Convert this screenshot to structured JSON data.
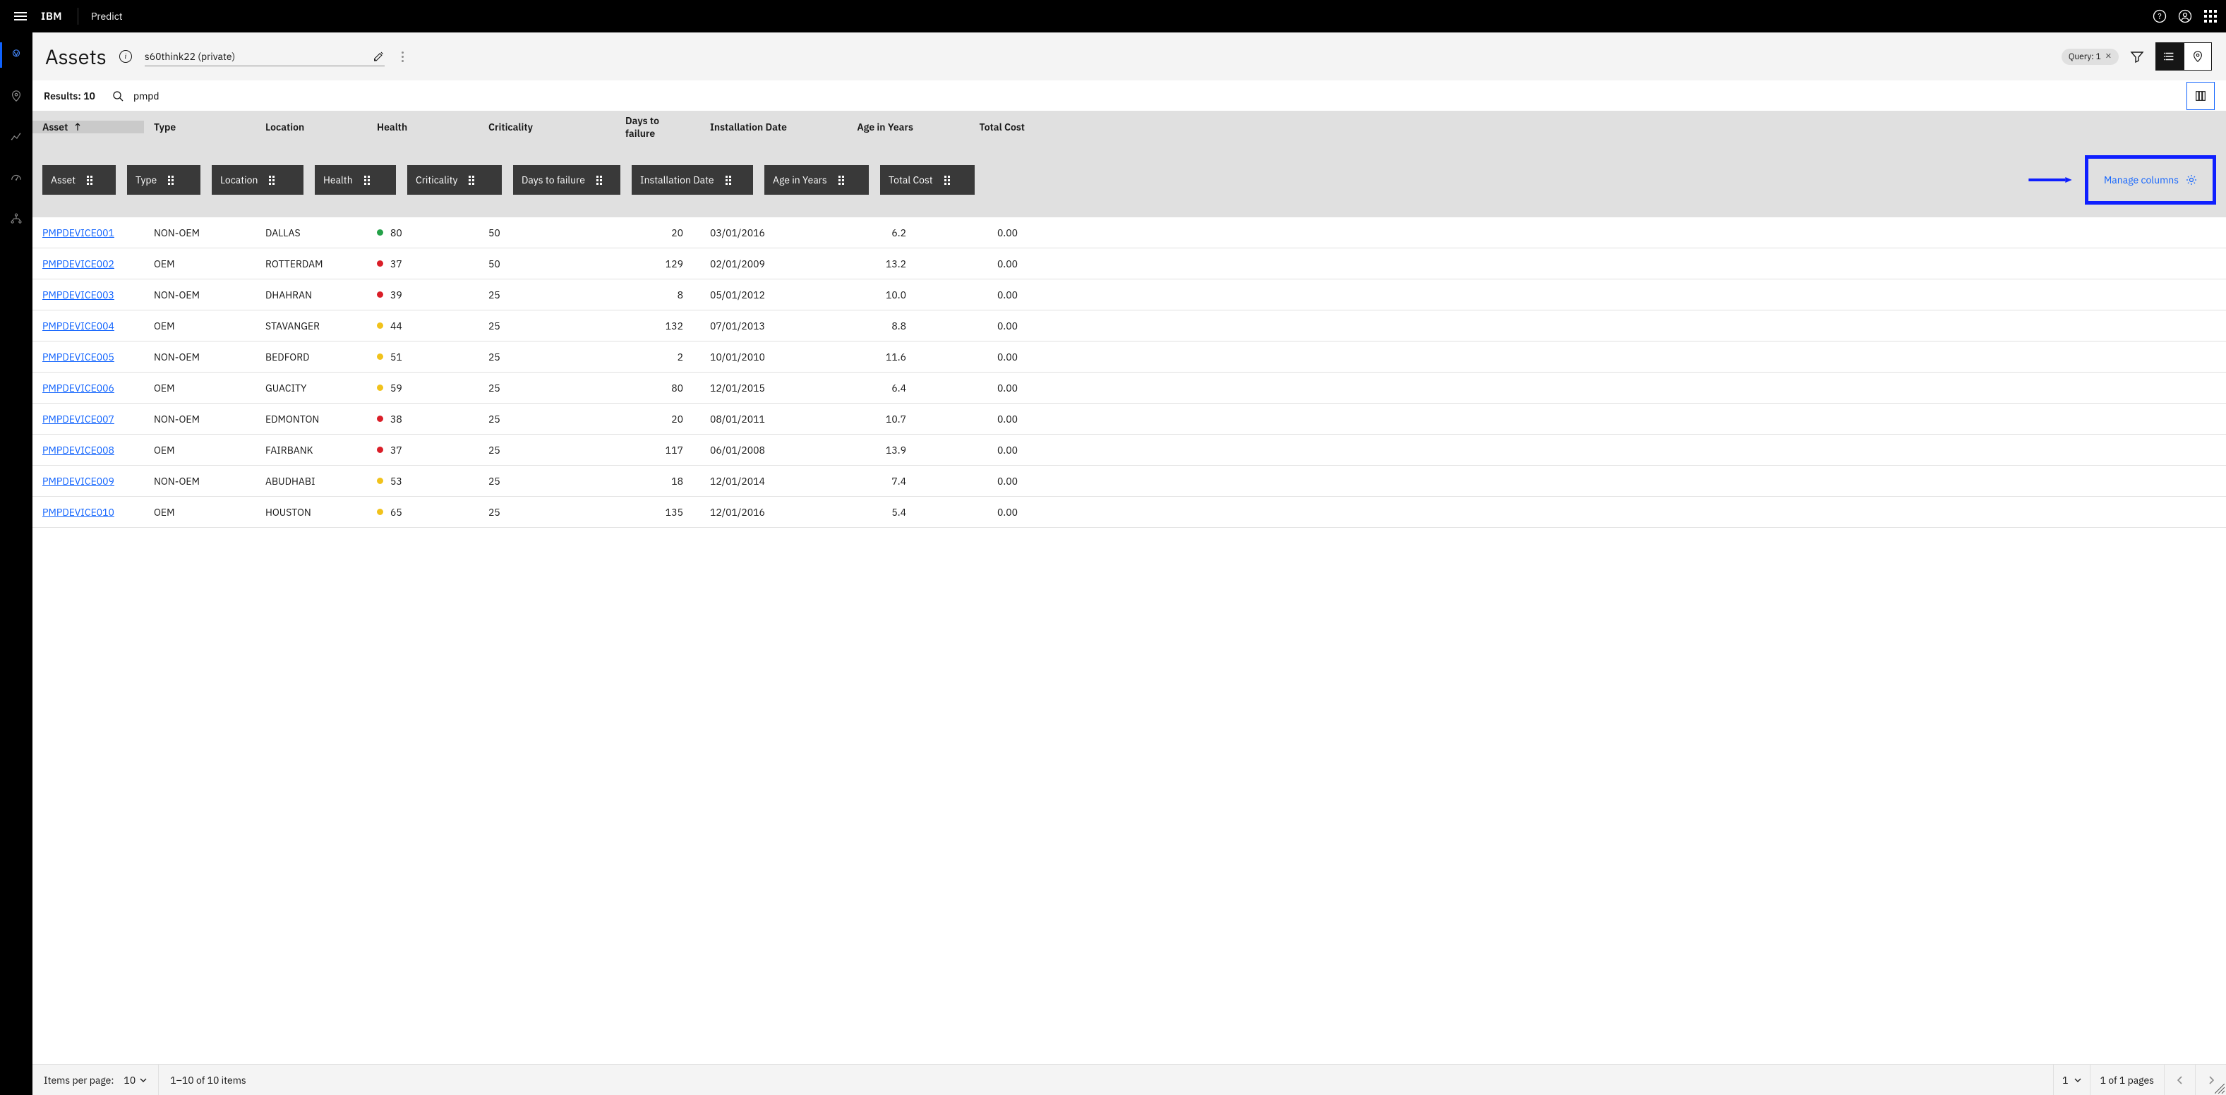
{
  "header": {
    "brand": "IBM",
    "app": "Predict"
  },
  "page": {
    "title": "Assets",
    "query_input": "s60think22 (private)",
    "query_badge_label": "Query: 1"
  },
  "results": {
    "label": "Results: 10",
    "search_value": "pmpd"
  },
  "columns": {
    "primary": [
      "Asset",
      "Type",
      "Location",
      "Health",
      "Criticality",
      "Days to failure",
      "Installation Date",
      "Age in Years",
      "Total Cost"
    ],
    "chips": [
      "Asset",
      "Type",
      "Location",
      "Health",
      "Criticality",
      "Days to failure",
      "Installation Date",
      "Age in Years",
      "Total Cost"
    ],
    "manage_label": "Manage columns"
  },
  "rows": [
    {
      "asset": "PMPDEVICE001",
      "type": "NON-OEM",
      "location": "DALLAS",
      "health_color": "green",
      "health": "80",
      "criticality": "50",
      "days": "20",
      "install": "03/01/2016",
      "age": "6.2",
      "cost": "0.00"
    },
    {
      "asset": "PMPDEVICE002",
      "type": "OEM",
      "location": "ROTTERDAM",
      "health_color": "red",
      "health": "37",
      "criticality": "50",
      "days": "129",
      "install": "02/01/2009",
      "age": "13.2",
      "cost": "0.00"
    },
    {
      "asset": "PMPDEVICE003",
      "type": "NON-OEM",
      "location": "DHAHRAN",
      "health_color": "red",
      "health": "39",
      "criticality": "25",
      "days": "8",
      "install": "05/01/2012",
      "age": "10.0",
      "cost": "0.00"
    },
    {
      "asset": "PMPDEVICE004",
      "type": "OEM",
      "location": "STAVANGER",
      "health_color": "yellow",
      "health": "44",
      "criticality": "25",
      "days": "132",
      "install": "07/01/2013",
      "age": "8.8",
      "cost": "0.00"
    },
    {
      "asset": "PMPDEVICE005",
      "type": "NON-OEM",
      "location": "BEDFORD",
      "health_color": "yellow",
      "health": "51",
      "criticality": "25",
      "days": "2",
      "install": "10/01/2010",
      "age": "11.6",
      "cost": "0.00"
    },
    {
      "asset": "PMPDEVICE006",
      "type": "OEM",
      "location": "GUACITY",
      "health_color": "yellow",
      "health": "59",
      "criticality": "25",
      "days": "80",
      "install": "12/01/2015",
      "age": "6.4",
      "cost": "0.00"
    },
    {
      "asset": "PMPDEVICE007",
      "type": "NON-OEM",
      "location": "EDMONTON",
      "health_color": "red",
      "health": "38",
      "criticality": "25",
      "days": "20",
      "install": "08/01/2011",
      "age": "10.7",
      "cost": "0.00"
    },
    {
      "asset": "PMPDEVICE008",
      "type": "OEM",
      "location": "FAIRBANK",
      "health_color": "red",
      "health": "37",
      "criticality": "25",
      "days": "117",
      "install": "06/01/2008",
      "age": "13.9",
      "cost": "0.00"
    },
    {
      "asset": "PMPDEVICE009",
      "type": "NON-OEM",
      "location": "ABUDHABI",
      "health_color": "yellow",
      "health": "53",
      "criticality": "25",
      "days": "18",
      "install": "12/01/2014",
      "age": "7.4",
      "cost": "0.00"
    },
    {
      "asset": "PMPDEVICE010",
      "type": "OEM",
      "location": "HOUSTON",
      "health_color": "yellow",
      "health": "65",
      "criticality": "25",
      "days": "135",
      "install": "12/01/2016",
      "age": "5.4",
      "cost": "0.00"
    }
  ],
  "pagination": {
    "per_page_label": "Items per page:",
    "per_page_value": "10",
    "range": "1–10 of 10 items",
    "page": "1",
    "of_pages": "1 of 1 pages"
  }
}
